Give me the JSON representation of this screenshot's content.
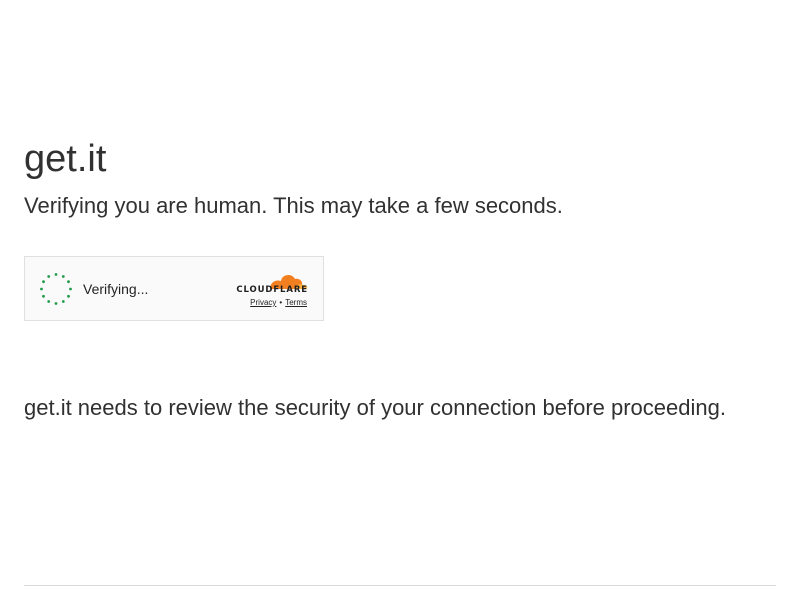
{
  "page": {
    "site_name": "get.it",
    "subtitle": "Verifying you are human. This may take a few seconds.",
    "security_message": "get.it needs to review the security of your connection before proceeding."
  },
  "challenge_widget": {
    "status_text": "Verifying...",
    "brand": "CLOUDFLARE",
    "privacy_label": "Privacy",
    "separator": "•",
    "terms_label": "Terms",
    "spinner_icon": "loading-spinner-icon",
    "colors": {
      "spinner": "#1f9b4b",
      "cloud_orange": "#f38020",
      "cloud_light_orange": "#faae40",
      "border": "#e0e0e0",
      "background": "#fafafa"
    }
  }
}
